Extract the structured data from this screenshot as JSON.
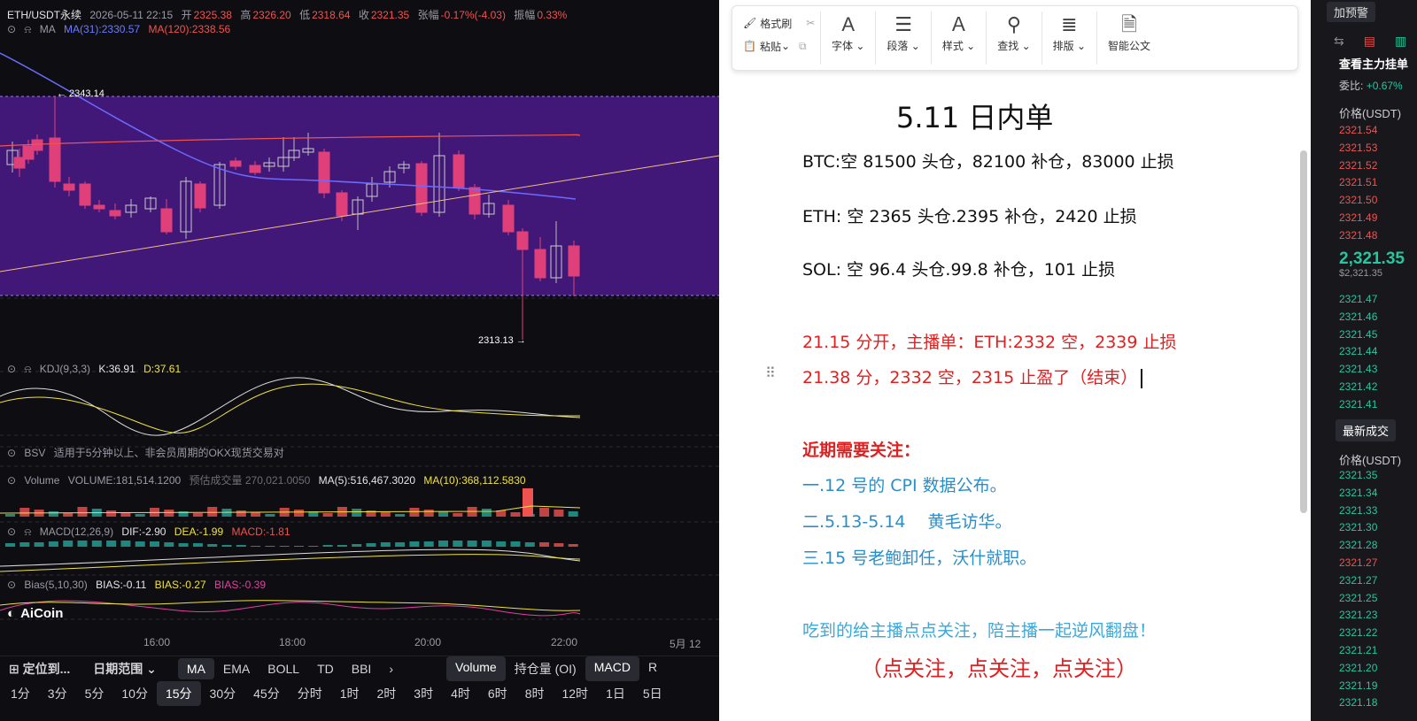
{
  "chart": {
    "header": {
      "symbol": "ETH/USDT永续",
      "datetime": "2026-05-11 22:15",
      "open_label": "开",
      "open": "2325.38",
      "high_label": "高",
      "high": "2326.20",
      "low_label": "低",
      "low": "2318.64",
      "close_label": "收",
      "close": "2321.35",
      "change_label": "张幅",
      "change": "-0.17%(-4.03)",
      "amp_label": "振幅",
      "amp": "0.33%"
    },
    "ma_line": {
      "label": "MA",
      "ma31": "MA(31):2330.57",
      "ma120": "MA(120):2338.56"
    },
    "price_high_label": "← 2343.14",
    "price_low_label": "2313.13 →",
    "kdj": {
      "label": "KDJ(9,3,3)",
      "k": "K:36.91",
      "d": "D:37.61"
    },
    "bsv": {
      "label": "BSV",
      "note": "适用于5分钟以上、非会员周期的OKX现货交易对"
    },
    "volume": {
      "label": "Volume",
      "vol": "VOLUME:181,514.1200",
      "est": "预估成交量 270,021.0050",
      "ma5": "MA(5):516,467.3020",
      "ma10": "MA(10):368,112.5830"
    },
    "macd": {
      "label": "MACD(12,26,9)",
      "dif": "DIF:-2.90",
      "dea": "DEA:-1.99",
      "macd": "MACD:-1.81"
    },
    "bias": {
      "label": "Bias(5,10,30)",
      "b1": "BIAS:-0.11",
      "b2": "BIAS:-0.27",
      "b3": "BIAS:-0.39"
    },
    "logo": "AiCoin",
    "time_axis": [
      "16:00",
      "18:00",
      "20:00",
      "22:00",
      "5月 12"
    ],
    "toolbar1": {
      "locate": "定位到...",
      "range": "日期范围",
      "indicators": [
        "MA",
        "EMA",
        "BOLL",
        "TD",
        "BBI"
      ],
      "more": "›",
      "sub_indicators": [
        "Volume",
        "持仓量 (OI)",
        "MACD",
        "R"
      ]
    },
    "periods": [
      "1分",
      "3分",
      "5分",
      "10分",
      "15分",
      "30分",
      "45分",
      "分时",
      "1时",
      "2时",
      "3时",
      "4时",
      "6时",
      "8时",
      "12时",
      "1日",
      "5日"
    ],
    "active_period": "15分",
    "colors": {
      "up": "#26a69a",
      "down": "#ef5350",
      "candle_down": "#e0407a",
      "range_fill": "#4a1a8a"
    }
  },
  "doc": {
    "ribbon": {
      "format_painter": "格式刷",
      "paste": "粘贴",
      "font": "字体",
      "paragraph": "段落",
      "style": "样式",
      "find": "查找",
      "layout": "排版",
      "smart": "智能公文"
    },
    "title": "5.11 日内单",
    "lines": [
      "BTC:空 81500 头仓，82100 补仓，83000 止损",
      "ETH: 空 2365 头仓.2395 补仓，2420 止损",
      "SOL: 空 96.4 头仓.99.8 补仓，101 止损"
    ],
    "red_lines": [
      "21.15 分开，主播单：ETH:2332 空，2339 止损",
      "21.38 分，2332 空，2315 止盈了（结束）"
    ],
    "focus_title": "近期需要关注：",
    "focus_items": [
      "一.12 号的 CPI 数据公布。",
      "二.5.13-5.14　 黄毛访华。",
      "三.15 号老鲍卸任，沃什就职。"
    ],
    "call": "吃到的给主播点点关注，陪主播一起逆风翻盘！",
    "call2": "（点关注，点关注，点关注）"
  },
  "book": {
    "alert_btn": "加预警",
    "heavy_title": "查看主力挂单",
    "ratio_label": "委比:",
    "ratio": "+0.67%",
    "price_label": "价格(USDT)",
    "asks": [
      "2321.54",
      "2321.53",
      "2321.52",
      "2321.51",
      "2321.50",
      "2321.49",
      "2321.48"
    ],
    "last": "2,321.35",
    "last_sub": "$2,321.35",
    "bids": [
      "2321.47",
      "2321.46",
      "2321.45",
      "2321.44",
      "2321.43",
      "2321.42",
      "2321.41"
    ],
    "trades_tab": "最新成交",
    "trades_price_label": "价格(USDT)",
    "trades": [
      "2321.35",
      "2321.34",
      "2321.33",
      "2321.30",
      "2321.28",
      "2321.27",
      "2321.27",
      "2321.25",
      "2321.23",
      "2321.22",
      "2321.21",
      "2321.20",
      "2321.19",
      "2321.18"
    ],
    "trade_red_index": 5
  }
}
